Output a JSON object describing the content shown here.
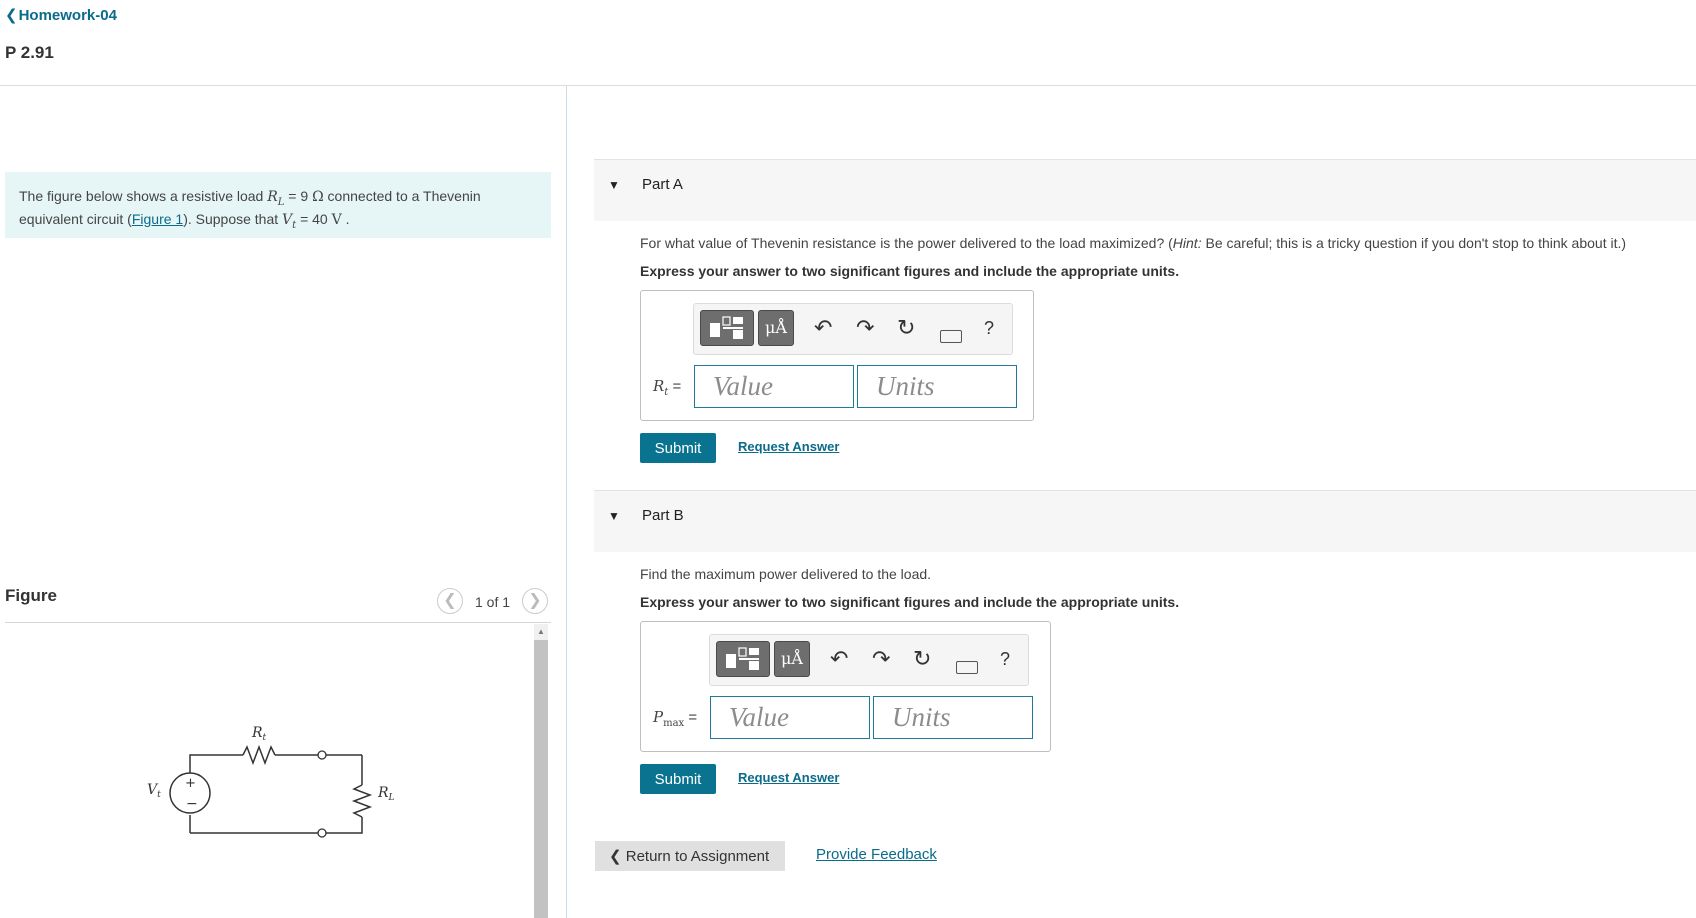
{
  "header": {
    "back_label": "Homework-04",
    "problem_title": "P 2.91"
  },
  "problem": {
    "text_1": "The figure below shows a resistive load ",
    "rl_symbol": "R",
    "rl_sub": "L",
    "rl_value": " = 9 ",
    "ohm": "Ω",
    "text_2": " connected to a Thevenin equivalent circuit (",
    "figure_link": "Figure 1",
    "text_3": "). Suppose that ",
    "vt_symbol": "V",
    "vt_sub": "t",
    "vt_value": " = 40 ",
    "volt": "V",
    "text_4": " ."
  },
  "figure": {
    "label": "Figure",
    "count": "1 of 1",
    "rt_label": "R",
    "rt_sub": "t",
    "vt_label": "V",
    "vt_sub": "t",
    "rl_label": "R",
    "rl_sub": "L",
    "plus": "+",
    "minus": "−"
  },
  "parts": [
    {
      "label": "Part A",
      "question": "For what value of Thevenin resistance is the power delivered to the load maximized? (",
      "hint_label": "Hint:",
      "question_2": " Be careful; this is a tricky question if you don't stop to think about it.)",
      "instruction": "Express your answer to two significant figures and include the appropriate units.",
      "answer_symbol": "R",
      "answer_sub": "t",
      "value_placeholder": "Value",
      "units_placeholder": "Units",
      "submit": "Submit",
      "request": "Request Answer"
    },
    {
      "label": "Part B",
      "question": "Find the maximum power delivered to the load.",
      "instruction": "Express your answer to two significant figures and include the appropriate units.",
      "answer_symbol": "P",
      "answer_sub": "max",
      "value_placeholder": "Value",
      "units_placeholder": "Units",
      "submit": "Submit",
      "request": "Request Answer"
    }
  ],
  "toolbar": {
    "units_btn": "μÅ",
    "help": "?",
    "equals": " ="
  },
  "footer": {
    "return_label": "Return to Assignment",
    "feedback_label": "Provide Feedback"
  }
}
